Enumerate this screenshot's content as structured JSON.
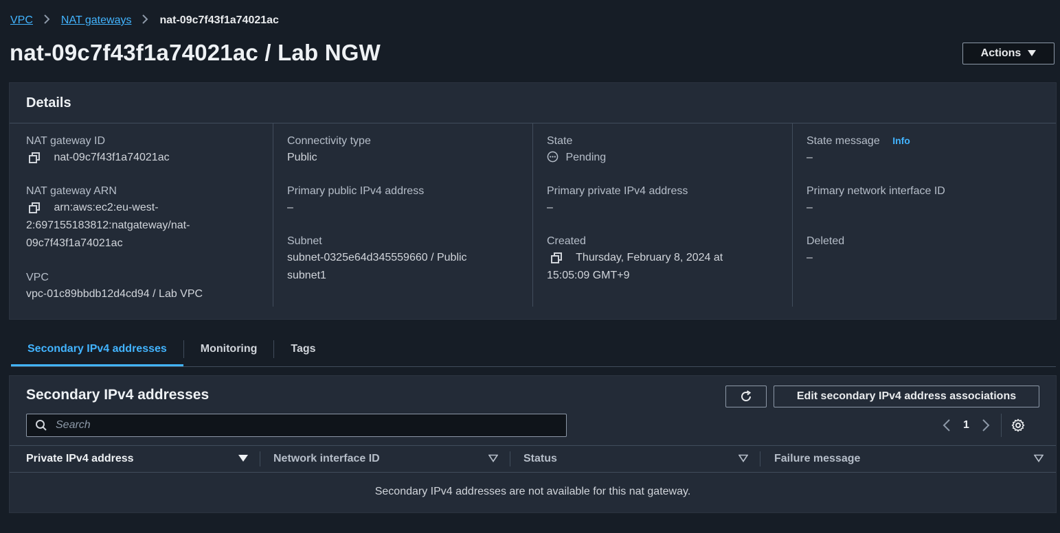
{
  "breadcrumb": {
    "items": [
      "VPC",
      "NAT gateways"
    ],
    "current": "nat-09c7f43f1a74021ac"
  },
  "page": {
    "title": "nat-09c7f43f1a74021ac / Lab NGW",
    "actions_label": "Actions"
  },
  "details": {
    "header": "Details",
    "nat_gateway_id": {
      "label": "NAT gateway ID",
      "value": "nat-09c7f43f1a74021ac"
    },
    "nat_gateway_arn": {
      "label": "NAT gateway ARN",
      "value_lines": [
        "arn:aws:ec2:eu-west-",
        "2:697155183812:natgateway/nat-",
        "09c7f43f1a74021ac"
      ]
    },
    "vpc": {
      "label": "VPC",
      "value": "vpc-01c89bbdb12d4cd94 / Lab VPC"
    },
    "connectivity_type": {
      "label": "Connectivity type",
      "value": "Public"
    },
    "primary_public_ipv4": {
      "label": "Primary public IPv4 address",
      "value": "–"
    },
    "subnet": {
      "label": "Subnet",
      "value_lines": [
        "subnet-0325e64d345559660 / Public",
        "subnet1"
      ]
    },
    "state": {
      "label": "State",
      "value": "Pending"
    },
    "primary_private_ipv4": {
      "label": "Primary private IPv4 address",
      "value": "–"
    },
    "created": {
      "label": "Created",
      "value_lines": [
        "Thursday, February 8, 2024 at",
        "15:05:09 GMT+9"
      ]
    },
    "state_message": {
      "label": "State message",
      "info": "Info",
      "value": "–"
    },
    "primary_network_interface_id": {
      "label": "Primary network interface ID",
      "value": "–"
    },
    "deleted": {
      "label": "Deleted",
      "value": "–"
    }
  },
  "tabs": [
    {
      "label": "Secondary IPv4 addresses",
      "active": true
    },
    {
      "label": "Monitoring"
    },
    {
      "label": "Tags"
    }
  ],
  "secondary": {
    "title": "Secondary IPv4 addresses",
    "edit_label": "Edit secondary IPv4 address associations",
    "search_placeholder": "Search",
    "page_number": "1",
    "columns": [
      "Private IPv4 address",
      "Network interface ID",
      "Status",
      "Failure message"
    ],
    "empty_message": "Secondary IPv4 addresses are not available for this nat gateway."
  },
  "icons": {
    "copy": "copy-icon",
    "pending": "pending-status-icon",
    "refresh": "refresh-icon",
    "search": "search-icon",
    "settings": "gear-icon"
  },
  "colors": {
    "background": "#161d26",
    "panel": "#232b37",
    "link": "#42b4ff",
    "border": "#414d5c"
  }
}
